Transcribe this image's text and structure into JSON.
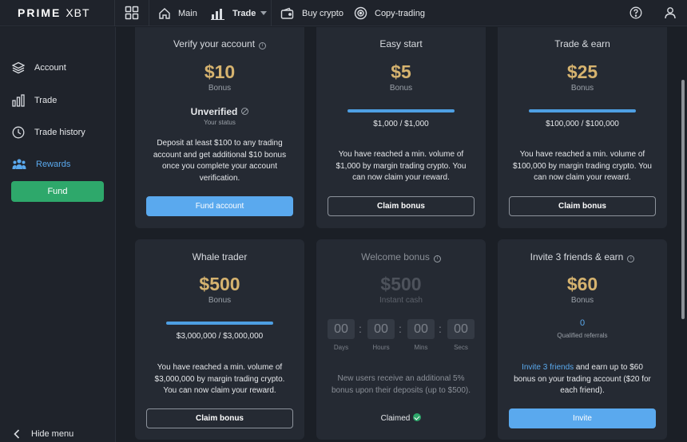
{
  "app": {
    "logo_left": "PRIME",
    "logo_right": "XBT"
  },
  "topnav": {
    "items": [
      {
        "label": "Main"
      },
      {
        "label": "Trade"
      },
      {
        "label": "Buy crypto"
      },
      {
        "label": "Copy-trading"
      }
    ]
  },
  "sidebar": {
    "items": [
      {
        "label": "Account"
      },
      {
        "label": "Trade"
      },
      {
        "label": "Trade history"
      },
      {
        "label": "Rewards"
      }
    ],
    "fund_label": "Fund",
    "hide_menu_label": "Hide menu"
  },
  "colors": {
    "accent": "#5aa9ee",
    "success": "#2ea86b",
    "bonus_gold": "#d6b36f",
    "card_bg": "#252a33"
  },
  "cards": {
    "verify": {
      "title": "Verify your account",
      "amount": "$10",
      "amount_label": "Bonus",
      "status": "Unverified",
      "status_label": "Your status",
      "description": "Deposit at least $100 to any trading account and get additional $10 bonus once you complete your account verification.",
      "button": "Fund account"
    },
    "easy_start": {
      "title": "Easy start",
      "amount": "$5",
      "amount_label": "Bonus",
      "progress_text": "$1,000 / $1,000",
      "progress": 1.0,
      "description": "You have reached a min. volume of $1,000 by margin trading crypto. You can now claim your reward.",
      "button": "Claim bonus"
    },
    "trade_earn": {
      "title": "Trade & earn",
      "amount": "$25",
      "amount_label": "Bonus",
      "progress_text": "$100,000 / $100,000",
      "progress": 1.0,
      "description": "You have reached a min. volume of $100,000 by margin trading crypto. You can now claim your reward.",
      "button": "Claim bonus"
    },
    "whale": {
      "title": "Whale trader",
      "amount": "$500",
      "amount_label": "Bonus",
      "progress_text": "$3,000,000 / $3,000,000",
      "progress": 1.0,
      "description": "You have reached a min. volume of $3,000,000 by margin trading crypto. You can now claim your reward.",
      "button": "Claim bonus"
    },
    "welcome": {
      "title": "Welcome bonus",
      "amount": "$500",
      "amount_label": "Instant cash",
      "timer": [
        {
          "value": "00",
          "label": "Days"
        },
        {
          "value": "00",
          "label": "Hours"
        },
        {
          "value": "00",
          "label": "Mins"
        },
        {
          "value": "00",
          "label": "Secs"
        }
      ],
      "description": "New users receive an additional 5% bonus upon their deposits (up to $500).",
      "claimed_label": "Claimed"
    },
    "invite": {
      "title": "Invite 3 friends & earn",
      "amount": "$60",
      "amount_label": "Bonus",
      "referrals_count": "0",
      "referrals_label": "Qualified referrals",
      "description_link": "Invite 3 friends",
      "description_rest": " and earn up to $60 bonus on your trading account ($20 for each friend).",
      "button": "Invite"
    }
  }
}
